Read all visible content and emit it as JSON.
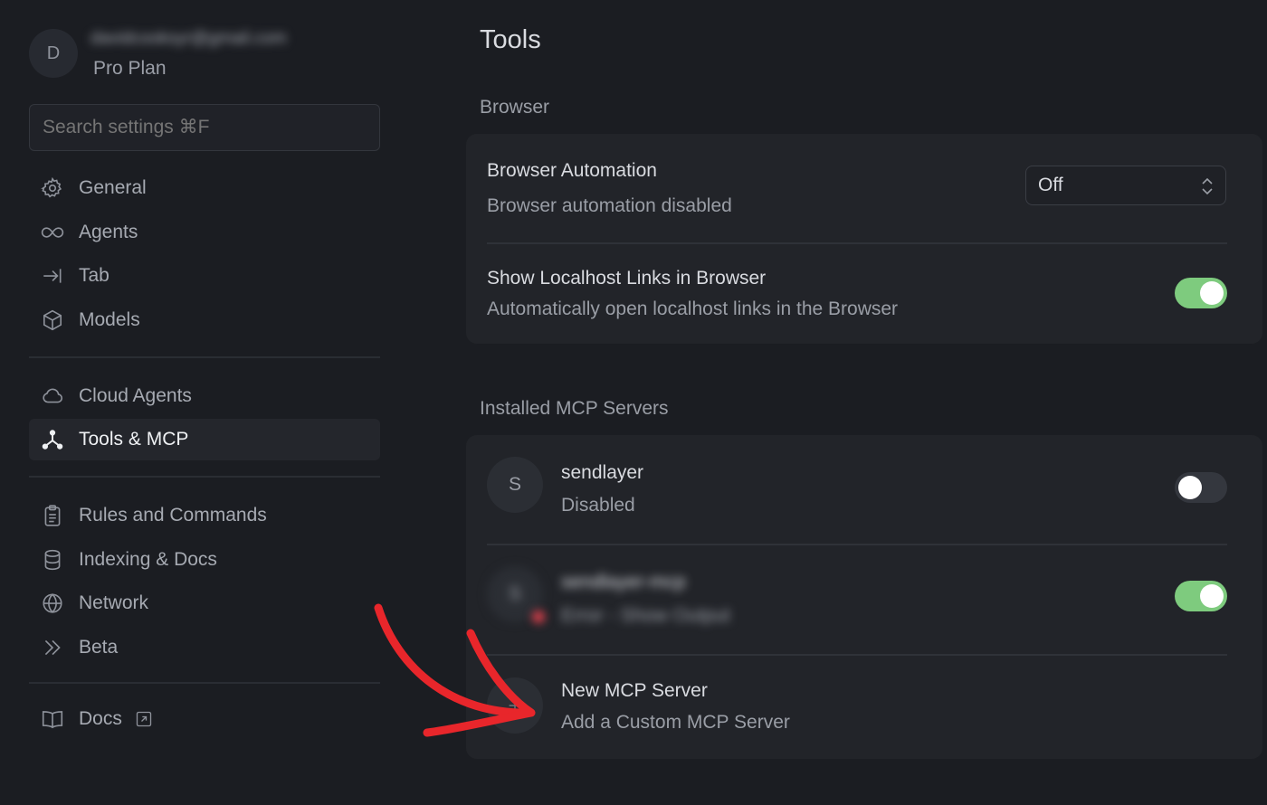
{
  "account": {
    "avatar_initial": "D",
    "email": "davidcooksyr@gmail.com",
    "plan": "Pro Plan"
  },
  "search": {
    "placeholder": "Search settings ⌘F"
  },
  "nav": {
    "general": "General",
    "agents": "Agents",
    "tab": "Tab",
    "models": "Models",
    "cloud_agents": "Cloud Agents",
    "tools_mcp": "Tools & MCP",
    "rules": "Rules and Commands",
    "indexing": "Indexing & Docs",
    "network": "Network",
    "beta": "Beta",
    "docs": "Docs"
  },
  "page": {
    "title": "Tools",
    "browser_section": "Browser",
    "mcp_section": "Installed MCP Servers"
  },
  "browser": {
    "automation_title": "Browser Automation",
    "automation_sub": "Browser automation disabled",
    "automation_value": "Off",
    "localhost_title": "Show Localhost Links in Browser",
    "localhost_sub": "Automatically open localhost links in the Browser",
    "localhost_enabled": true
  },
  "servers": [
    {
      "initial": "S",
      "name": "sendlayer",
      "status": "Disabled",
      "enabled": false
    },
    {
      "initial": "S",
      "name": "sendlayer-mcp",
      "status": "Error - Show Output",
      "enabled": true
    }
  ],
  "new_server": {
    "icon": "plus-icon",
    "title": "New MCP Server",
    "sub": "Add a Custom MCP Server"
  },
  "colors": {
    "toggle_on": "#7ecb7e",
    "annotation_arrow": "#e8262b",
    "error_dot": "#e0414d"
  }
}
